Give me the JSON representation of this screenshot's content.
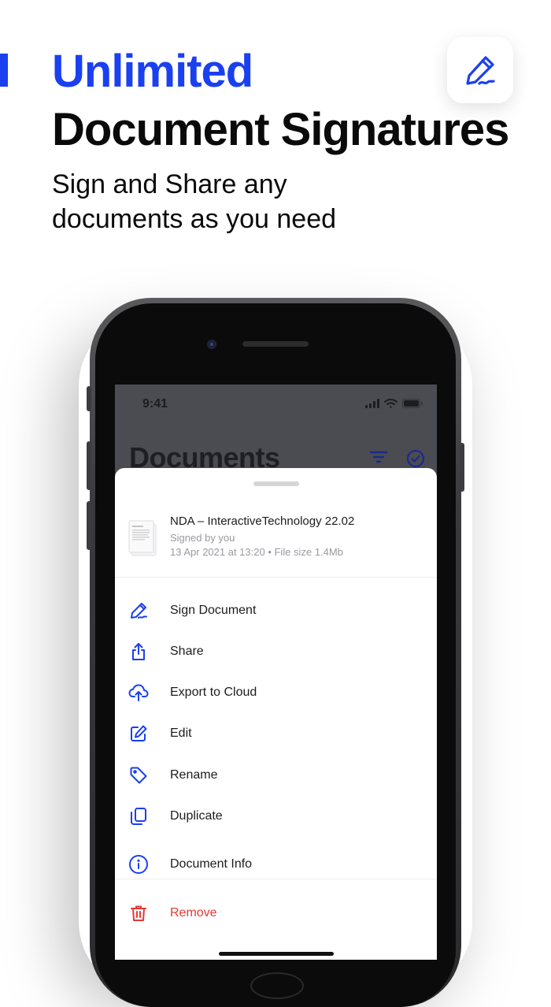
{
  "headline": {
    "line1": "Unlimited",
    "line2": "Document Signatures",
    "subtitle": "Sign and Share any documents as you need"
  },
  "app_icon": "pen-signature-icon",
  "colors": {
    "accent": "#1a40f0",
    "danger": "#e53935"
  },
  "status_bar": {
    "time": "9:41"
  },
  "screen": {
    "title": "Documents",
    "icons": [
      "filter-icon",
      "select-check-icon"
    ]
  },
  "file": {
    "name": "NDA – InteractiveTechnology 22.02",
    "signed_by": "Signed by you",
    "meta": "13 Apr 2021 at 13:20 • File size 1.4Mb"
  },
  "menu": {
    "items": [
      {
        "label": "Sign Document",
        "icon": "pen-icon"
      },
      {
        "label": "Share",
        "icon": "share-icon"
      },
      {
        "label": "Export to Cloud",
        "icon": "cloud-upload-icon"
      },
      {
        "label": "Edit",
        "icon": "edit-icon"
      },
      {
        "label": "Rename",
        "icon": "tag-icon"
      },
      {
        "label": "Duplicate",
        "icon": "duplicate-icon"
      },
      {
        "label": "Document Info",
        "icon": "info-icon"
      },
      {
        "label": "Remove",
        "icon": "trash-icon"
      }
    ]
  }
}
